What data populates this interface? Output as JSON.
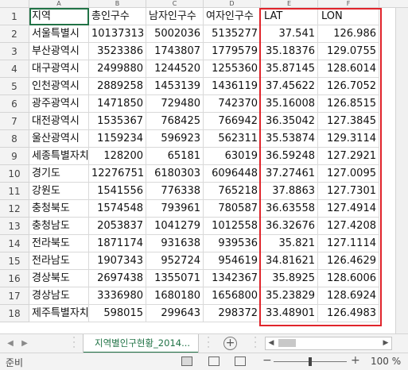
{
  "columns": [
    "A",
    "B",
    "C",
    "D",
    "E",
    "F"
  ],
  "header_row": [
    "지역",
    "총인구수",
    "남자인구수",
    "여자인구수",
    "LAT",
    "LON"
  ],
  "rows": [
    [
      "서울특별시",
      "10137313",
      "5002036",
      "5135277",
      "37.541",
      "126.986"
    ],
    [
      "부산광역시",
      "3523386",
      "1743807",
      "1779579",
      "35.18376",
      "129.0755"
    ],
    [
      "대구광역시",
      "2499880",
      "1244520",
      "1255360",
      "35.87145",
      "128.6014"
    ],
    [
      "인천광역시",
      "2889258",
      "1453139",
      "1436119",
      "37.45622",
      "126.7052"
    ],
    [
      "광주광역시",
      "1471850",
      "729480",
      "742370",
      "35.16008",
      "126.8515"
    ],
    [
      "대전광역시",
      "1535367",
      "768425",
      "766942",
      "36.35042",
      "127.3845"
    ],
    [
      "울산광역시",
      "1159234",
      "596923",
      "562311",
      "35.53874",
      "129.3114"
    ],
    [
      "세종특별자치시",
      "128200",
      "65181",
      "63019",
      "36.59248",
      "127.2921"
    ],
    [
      "경기도",
      "12276751",
      "6180303",
      "6096448",
      "37.27461",
      "127.0095"
    ],
    [
      "강원도",
      "1541556",
      "776338",
      "765218",
      "37.8863",
      "127.7301"
    ],
    [
      "충청북도",
      "1574548",
      "793961",
      "780587",
      "36.63558",
      "127.4914"
    ],
    [
      "충청남도",
      "2053837",
      "1041279",
      "1012558",
      "36.32676",
      "127.4208"
    ],
    [
      "전라북도",
      "1871174",
      "931638",
      "939536",
      "35.821",
      "127.1114"
    ],
    [
      "전라남도",
      "1907343",
      "952724",
      "954619",
      "34.81621",
      "126.4629"
    ],
    [
      "경상북도",
      "2697438",
      "1355071",
      "1342367",
      "35.8925",
      "128.6006"
    ],
    [
      "경상남도",
      "3336980",
      "1680180",
      "1656800",
      "35.23829",
      "128.6924"
    ],
    [
      "제주특별자치도",
      "598015",
      "299643",
      "298372",
      "33.48901",
      "126.4983"
    ]
  ],
  "sheet_tab": "지역별인구현황_2014...",
  "status": {
    "ready": "준비",
    "zoom": "100 %"
  },
  "colors": {
    "accent": "#217346",
    "highlight": "#e0242b"
  }
}
